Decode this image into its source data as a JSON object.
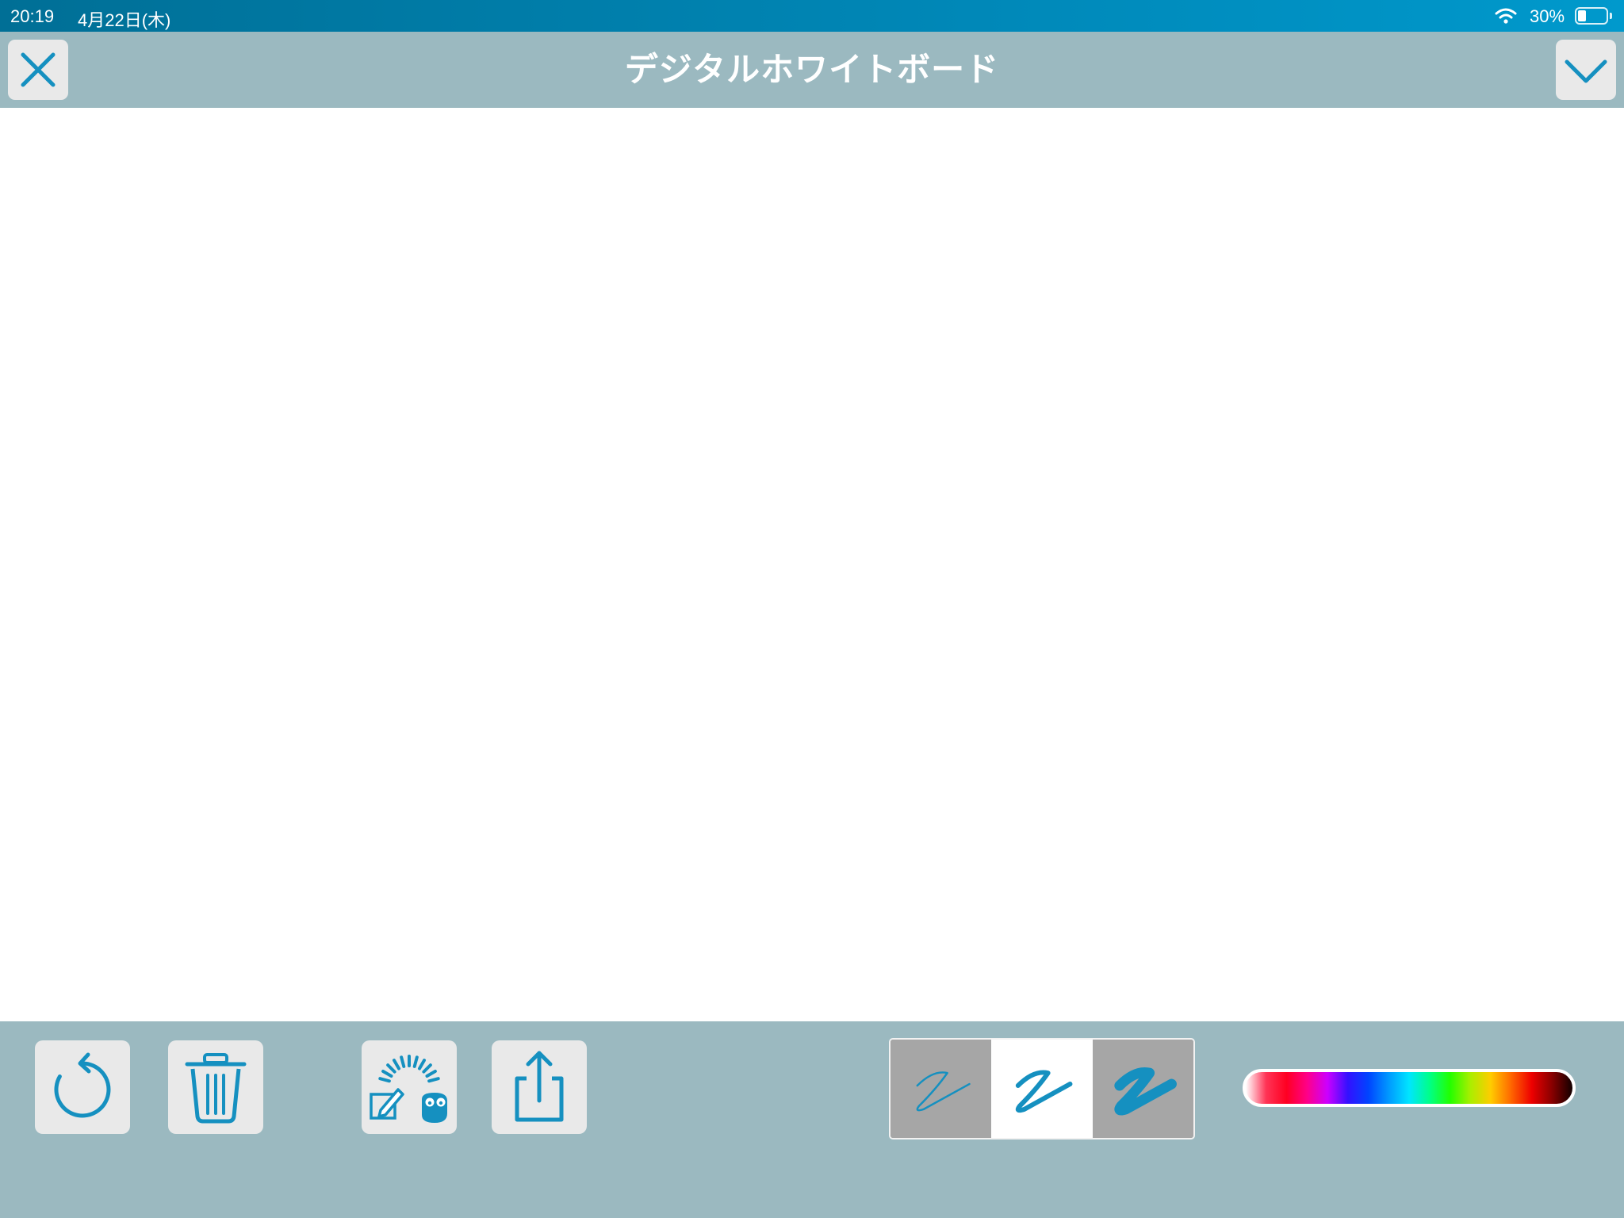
{
  "status_bar": {
    "time": "20:19",
    "date": "4月22日(木)",
    "battery_text": "30%",
    "battery_level": 0.3,
    "icons": [
      "wifi-icon",
      "battery-icon"
    ]
  },
  "header": {
    "title": "デジタルホワイトボード",
    "left_button_icon": "close-icon",
    "right_button_icon": "chevron-down-icon"
  },
  "toolbar": {
    "buttons": [
      {
        "name": "undo-button",
        "icon": "undo-icon"
      },
      {
        "name": "clear-button",
        "icon": "trash-icon"
      },
      {
        "name": "whiteboard-assistant-button",
        "icon": "note-owl-icon"
      },
      {
        "name": "share-button",
        "icon": "share-icon"
      }
    ],
    "pen_widths": {
      "options": [
        "pen-thin-icon",
        "pen-medium-icon",
        "pen-thick-icon"
      ],
      "selected_index": 1
    },
    "color_slider": {
      "gradient": [
        "#ffffff",
        "#ff3355",
        "#ff0022",
        "#ff0088",
        "#cc00ff",
        "#3311ff",
        "#0044ff",
        "#0099ff",
        "#00e5ff",
        "#00ff88",
        "#22ff00",
        "#aaee00",
        "#ffcc00",
        "#ff6600",
        "#ee0000",
        "#880000",
        "#120000"
      ]
    }
  },
  "colors": {
    "accent": "#1590c0",
    "bar_background": "#9bb9c0",
    "button_background": "#e9e9e9",
    "pen_unselected_background": "#a6a6a6",
    "canvas_background": "#ffffff"
  }
}
